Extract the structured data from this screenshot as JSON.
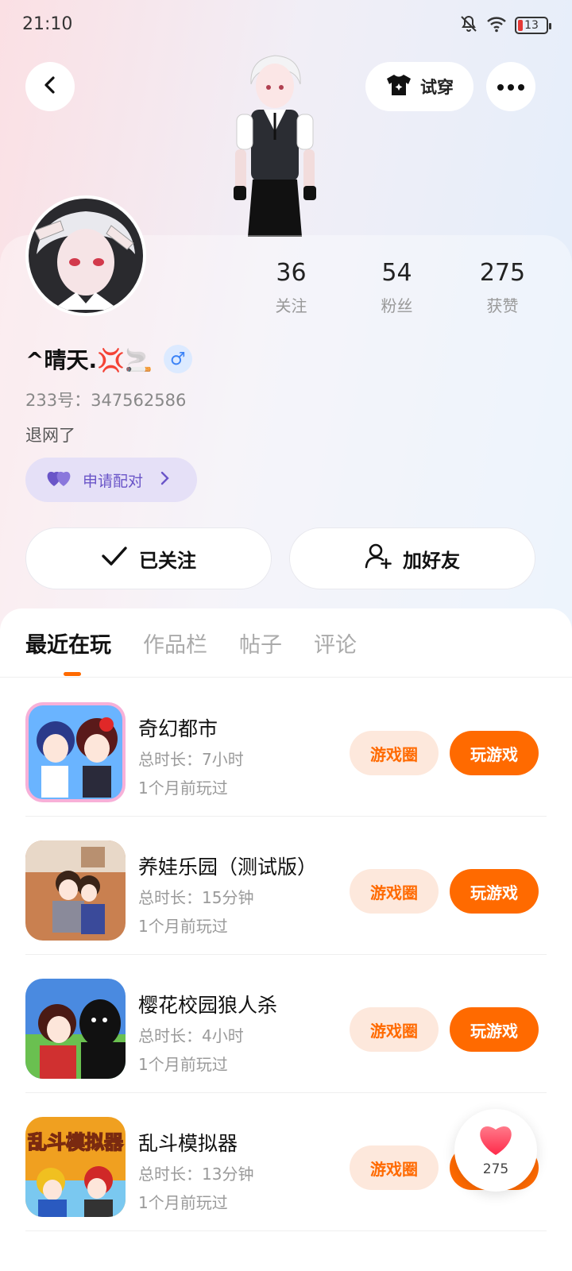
{
  "status_bar": {
    "time": "21:10",
    "battery": "13"
  },
  "header": {
    "tryon_label": "试穿"
  },
  "profile": {
    "stats": [
      {
        "value": "36",
        "label": "关注"
      },
      {
        "value": "54",
        "label": "粉丝"
      },
      {
        "value": "275",
        "label": "获赞"
      }
    ],
    "username": "^晴天.💢🚬",
    "gender": "♂",
    "uid": "233号：347562586",
    "bio": "退网了",
    "pair_label": "申请配对"
  },
  "actions": {
    "followed_label": "已关注",
    "add_friend_label": "加好友"
  },
  "tabs": [
    {
      "label": "最近在玩"
    },
    {
      "label": "作品栏"
    },
    {
      "label": "帖子"
    },
    {
      "label": "评论"
    }
  ],
  "games": [
    {
      "name": "奇幻都市",
      "duration": "总时长：7小时",
      "last_played": "1个月前玩过",
      "circle_label": "游戏圈",
      "play_label": "玩游戏"
    },
    {
      "name": "养娃乐园（测试版）",
      "duration": "总时长：15分钟",
      "last_played": "1个月前玩过",
      "circle_label": "游戏圈",
      "play_label": "玩游戏"
    },
    {
      "name": "樱花校园狼人杀",
      "duration": "总时长：4小时",
      "last_played": "1个月前玩过",
      "circle_label": "游戏圈",
      "play_label": "玩游戏"
    },
    {
      "name": "乱斗模拟器",
      "duration": "总时长：13分钟",
      "last_played": "1个月前玩过",
      "circle_label": "游戏圈",
      "play_label": "玩游戏",
      "icon_text": "乱斗模拟器"
    }
  ],
  "like_float": {
    "count": "275"
  },
  "colors": {
    "accent": "#ff6a00",
    "accent_soft": "#fde8dc",
    "pair_bg": "#e5e0f7",
    "pair_text": "#6a55c8",
    "gender": "#3b82f6"
  }
}
